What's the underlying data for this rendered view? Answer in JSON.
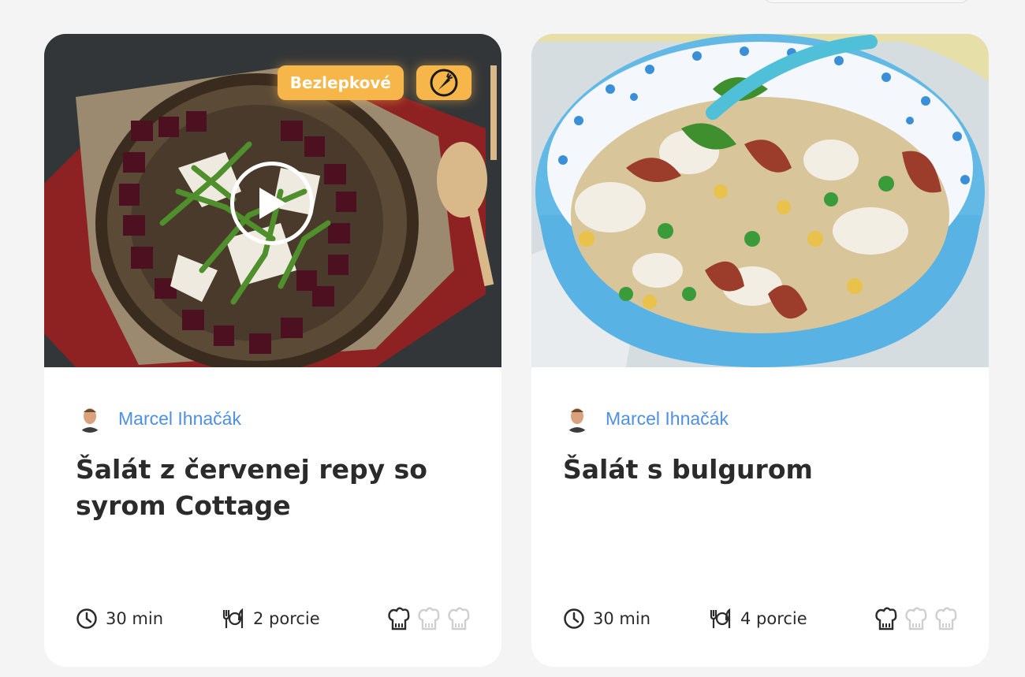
{
  "colors": {
    "badge": "#f6b64a",
    "author": "#4e8fe6",
    "title": "#2b2b2b",
    "hat_active": "#2b2b2b",
    "hat_inactive": "#cfcfcf"
  },
  "recipes": [
    {
      "badge_label": "Bezlepkové",
      "badge_icon": "carrot-icon",
      "has_video": true,
      "author": "Marcel Ihnačák",
      "title": "Šalát z červenej repy so syrom Cottage",
      "time": "30 min",
      "servings": "2 porcie",
      "difficulty": 1,
      "difficulty_max": 3
    },
    {
      "author": "Marcel Ihnačák",
      "title": "Šalát s bulgurom",
      "time": "30 min",
      "servings": "4 porcie",
      "difficulty": 1,
      "difficulty_max": 3
    }
  ]
}
